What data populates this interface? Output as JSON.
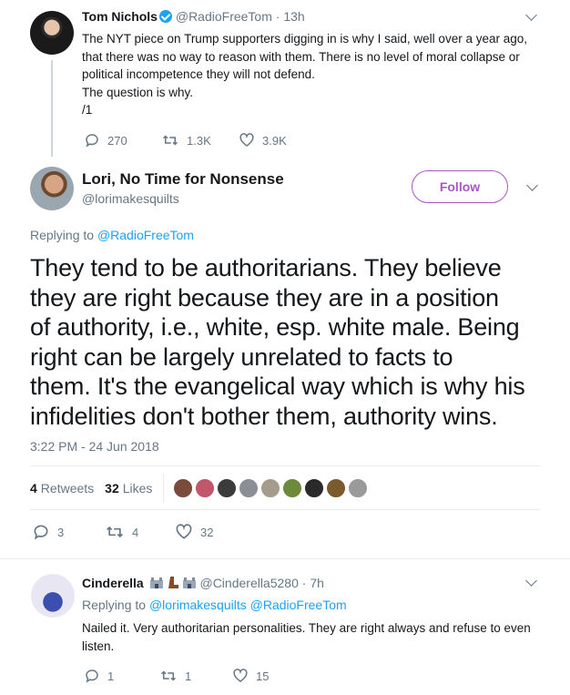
{
  "tweet1": {
    "name": "Tom Nichols",
    "handle": "@RadioFreeTom",
    "time": "· 13h",
    "text_lines": [
      "The NYT piece on Trump supporters digging in is why I said, well over a year ago,",
      "that there was no way to reason with them. There is no level of moral collapse or",
      "political incompetence they will not defend.",
      "The question is why.",
      "/1"
    ],
    "replies": "270",
    "retweets": "1.3K",
    "likes": "3.9K"
  },
  "main": {
    "name": "Lori, No Time for Nonsense",
    "handle": "@lorimakesquilts",
    "follow_label": "Follow",
    "replying_prefix": "Replying to",
    "replying_to": "@RadioFreeTom",
    "text_lines": [
      "They tend to be authoritarians. They believe",
      "they are right because they are in a position",
      "of authority, i.e., white, esp. white male. Being",
      "right can be largely unrelated to facts to",
      "them. It's the evangelical way which is why his",
      "infidelities don't bother them, authority wins."
    ],
    "timestamp": "3:22 PM - 24 Jun 2018",
    "retweet_count": "4",
    "retweet_label": "Retweets",
    "like_count": "32",
    "like_label": "Likes",
    "replies": "3",
    "retweets": "4",
    "likes": "32"
  },
  "reply": {
    "name": "Cinderella",
    "handle": "@Cinderella5280",
    "time": "· 7h",
    "replying_prefix": "Replying to",
    "replying_to": "@lorimakesquilts @RadioFreeTom",
    "text_lines": [
      "Nailed it. Very authoritarian personalities. They are right always and refuse to even",
      "listen."
    ],
    "replies": "1",
    "retweets": "1",
    "likes": "15"
  },
  "colors": {
    "accent": "#1da1f2",
    "follow": "#a855c8",
    "muted": "#657786"
  }
}
